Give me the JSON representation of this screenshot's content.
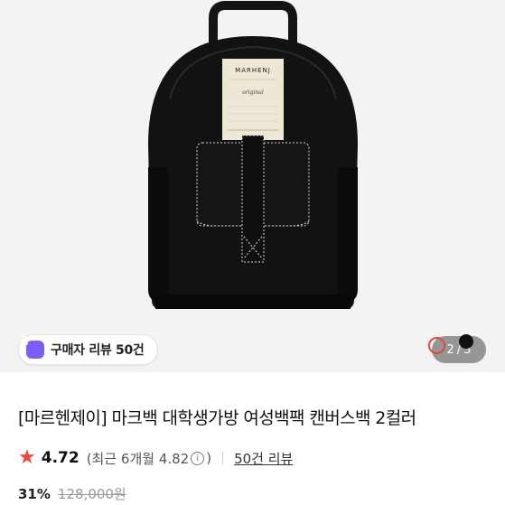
{
  "review_chip": {
    "label": "구매자 리뷰 50건"
  },
  "pager": {
    "current": "2",
    "separator": "/",
    "total": "3"
  },
  "product": {
    "title": "[마르헨제이] 마크백 대학생가방 여성백팩 캔버스백 2컬러",
    "rating": "4.72",
    "recent_rating": "(최근 6개월 4.82",
    "recent_close": ")",
    "review_link": "50건 리뷰",
    "discount": "31%",
    "original_price": "128,000원"
  },
  "bag_label": {
    "brand": "MARHENJ",
    "script": "original"
  },
  "colors": {
    "accent_star": "#f04438",
    "chip_icon": "#7d5cf5",
    "image_bg": "#f3f3f3",
    "bag": "#121212"
  },
  "icons": [
    "bag-icon",
    "star-icon",
    "info-icon"
  ]
}
